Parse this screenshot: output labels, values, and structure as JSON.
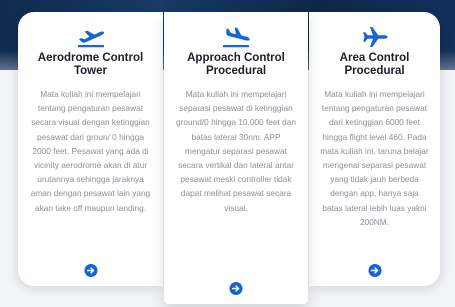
{
  "colors": {
    "accent": "#1565d8",
    "title": "#1b1f2a",
    "body_text": "#8a8f99",
    "hero": "#183a66"
  },
  "cards": [
    {
      "icon": "airplane-takeoff-icon",
      "title": "Aerodrome Control Tower",
      "description": "Mata kuliah ini mempelajari tentang pengaturan pesawat secara visual dengan ketinggian pesawat dari groun/ 0 hingga 2000 feet. Pesawat yang ada di vicinity aerodrome akan di atur urutannya sehingga jaraknya aman dengan pesawat lain yang akan take off maupun landing.",
      "more_icon": "arrow-right-circle-icon"
    },
    {
      "icon": "airplane-landing-icon",
      "title": "Approach Control Procedural",
      "description": "Mata kuliah ini mempelajari separasi pesawat di ketinggian ground/0 hingga 10.000 feet dan batas lateral 30nm. APP mengatur separasi pesawat secara vertikal dan lateral antar pesawat meski controller tidak dapat melihat pesawat secara visual.",
      "more_icon": "arrow-right-circle-icon"
    },
    {
      "icon": "airplane-icon",
      "title": "Area Control Procedural",
      "description": "Mata kuliah ini mempelajari tentang pengaturan pesawat dari ketinggian 6000 feet hingga flight level 460. Pada  mata kuliah ini, taruna belajar mengenai separasi pesawat yang tidak jauh berbeda dengan app, hanya saja batas lateral lebih luas yakni 200NM.",
      "more_icon": "arrow-right-circle-icon"
    }
  ]
}
